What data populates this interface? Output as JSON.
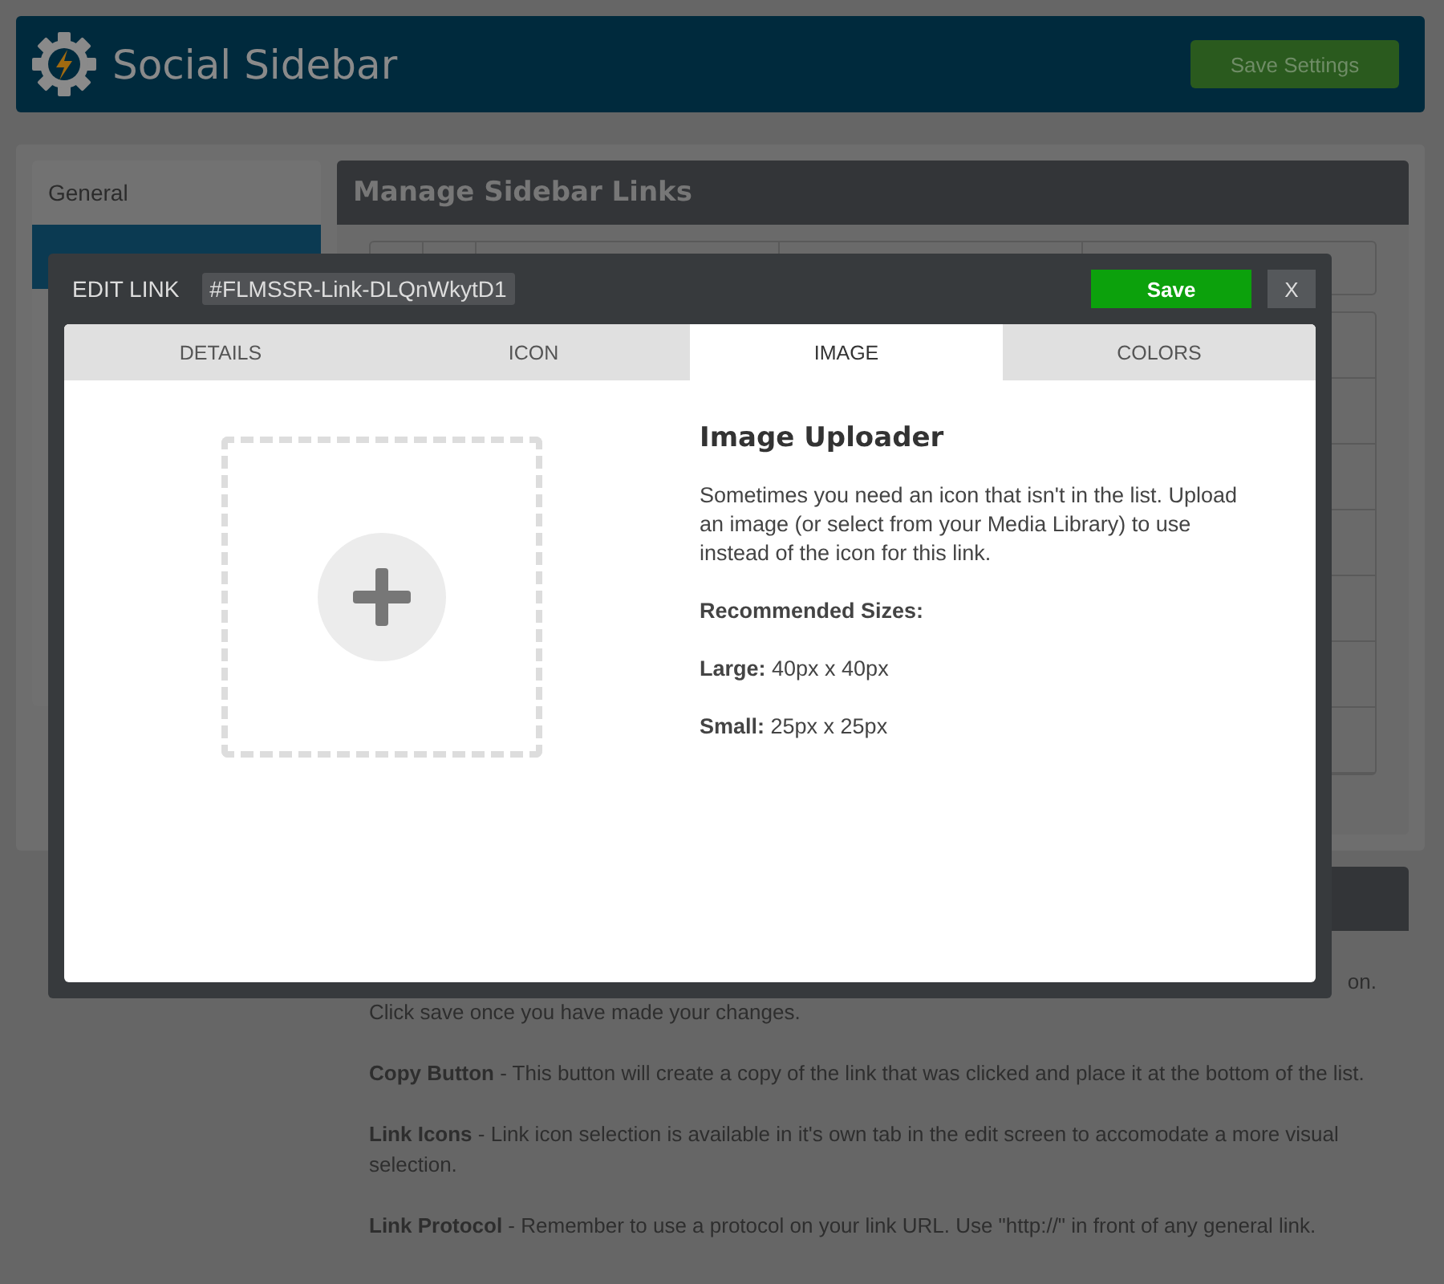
{
  "header": {
    "title": "Social Sidebar",
    "save_button": "Save Settings"
  },
  "sidebar": {
    "items": [
      {
        "label": "General",
        "selected": false
      },
      {
        "selected": true
      }
    ]
  },
  "links_panel": {
    "title": "Manage Sidebar Links"
  },
  "help_panel": {
    "fragment": "on.",
    "paragraphs": [
      "Click save once you have made your changes.",
      "**Copy Button**  -  This button will create a copy of the link that was clicked and place it at the bottom of the list.",
      "**Link Icons**  -  Link icon selection is available in it's own tab in the edit screen to accomodate a more visual selection.",
      "**Link Protocol**  -  Remember to use a protocol on your link URL. Use \"http://\" in front of any general link."
    ]
  },
  "modal": {
    "title": "EDIT LINK",
    "link_id": "#FLMSSR-Link-DLQnWkytD1",
    "save_button": "Save",
    "close_button": "X",
    "tabs": [
      {
        "label": "DETAILS",
        "selected": false
      },
      {
        "label": "ICON",
        "selected": false
      },
      {
        "label": "IMAGE",
        "selected": true
      },
      {
        "label": "COLORS",
        "selected": false
      }
    ],
    "uploader": {
      "heading": "Image Uploader",
      "description": "Sometimes you need an icon that isn't in the list. Upload an image (or select from your Media Library) to use instead of the icon for this link.",
      "sizes_label": "Recommended Sizes:",
      "sizes": [
        "**Large:** 40px x 40px",
        "**Small:** 25px x 25px"
      ]
    }
  }
}
